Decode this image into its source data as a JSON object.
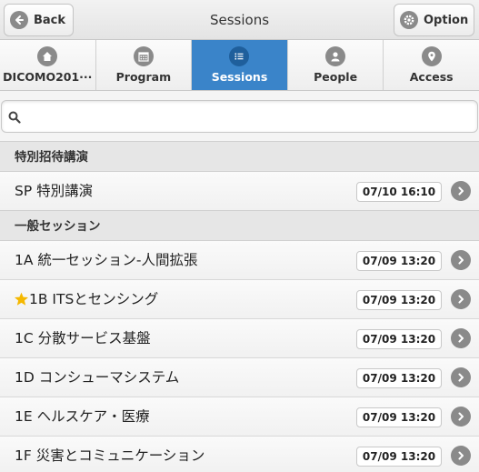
{
  "header": {
    "title": "Sessions",
    "back_label": "Back",
    "option_label": "Option"
  },
  "nav": {
    "items": [
      {
        "label": "DICOMO201···",
        "icon": "home-icon"
      },
      {
        "label": "Program",
        "icon": "calendar-icon"
      },
      {
        "label": "Sessions",
        "icon": "list-icon",
        "active": true
      },
      {
        "label": "People",
        "icon": "person-icon"
      },
      {
        "label": "Access",
        "icon": "map-pin-icon"
      }
    ]
  },
  "search": {
    "value": "",
    "placeholder": ""
  },
  "groups": [
    {
      "title": "特別招待講演",
      "sessions": [
        {
          "title": "SP 特別講演",
          "time": "07/10 16:10"
        }
      ]
    },
    {
      "title": "一般セッション",
      "sessions": [
        {
          "title": "1A 統一セッション-人間拡張",
          "time": "07/09 13:20"
        },
        {
          "title": "1B ITSとセンシング",
          "time": "07/09 13:20",
          "starred": true
        },
        {
          "title": "1C 分散サービス基盤",
          "time": "07/09 13:20"
        },
        {
          "title": "1D コンシューマシステム",
          "time": "07/09 13:20"
        },
        {
          "title": "1E ヘルスケア・医療",
          "time": "07/09 13:20"
        },
        {
          "title": "1F 災害とコミュニケーション",
          "time": "07/09 13:20"
        }
      ]
    }
  ],
  "colors": {
    "accent": "#3a84c9",
    "star": "#f5b800",
    "icon_gray": "#8a8a8a"
  }
}
